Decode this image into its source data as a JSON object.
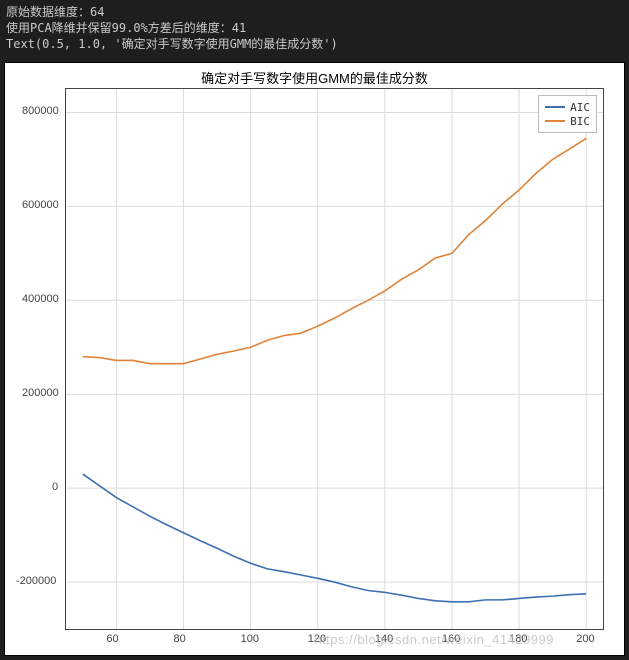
{
  "console": {
    "line1": "原始数据维度：64",
    "line2": "使用PCA降维并保留99.0%方差后的维度：41",
    "line3": "Text(0.5, 1.0, '确定对手写数字使用GMM的最佳成分数')"
  },
  "watermark": "https://blog.csdn.net/weixin_41429999",
  "chart_data": {
    "type": "line",
    "title": "确定对手写数字使用GMM的最佳成分数",
    "xlabel": "",
    "ylabel": "",
    "xlim": [
      45,
      205
    ],
    "ylim": [
      -300000,
      850000
    ],
    "xticks": [
      60,
      80,
      100,
      120,
      140,
      160,
      180,
      200
    ],
    "yticks": [
      -200000,
      0,
      200000,
      400000,
      600000,
      800000
    ],
    "legend": {
      "position": "upper right",
      "entries": [
        "AIC",
        "BIC"
      ]
    },
    "colors": {
      "AIC": "#3d6fb2",
      "BIC": "#e0843a"
    },
    "x": [
      50,
      55,
      60,
      65,
      70,
      75,
      80,
      85,
      90,
      95,
      100,
      105,
      110,
      115,
      120,
      125,
      130,
      135,
      140,
      145,
      150,
      155,
      160,
      165,
      170,
      175,
      180,
      185,
      190,
      195,
      200
    ],
    "series": [
      {
        "name": "AIC",
        "values": [
          30000,
          5000,
          -20000,
          -40000,
          -60000,
          -78000,
          -95000,
          -112000,
          -128000,
          -145000,
          -160000,
          -172000,
          -178000,
          -185000,
          -192000,
          -200000,
          -210000,
          -218000,
          -222000,
          -228000,
          -235000,
          -240000,
          -242000,
          -242000,
          -238000,
          -238000,
          -235000,
          -232000,
          -230000,
          -227000,
          -225000
        ]
      },
      {
        "name": "BIC",
        "values": [
          280000,
          278000,
          272000,
          272000,
          265000,
          265000,
          265000,
          275000,
          285000,
          292000,
          300000,
          315000,
          325000,
          330000,
          345000,
          362000,
          382000,
          400000,
          420000,
          445000,
          465000,
          490000,
          500000,
          540000,
          570000,
          605000,
          635000,
          670000,
          700000,
          722000,
          745000
        ]
      }
    ]
  }
}
